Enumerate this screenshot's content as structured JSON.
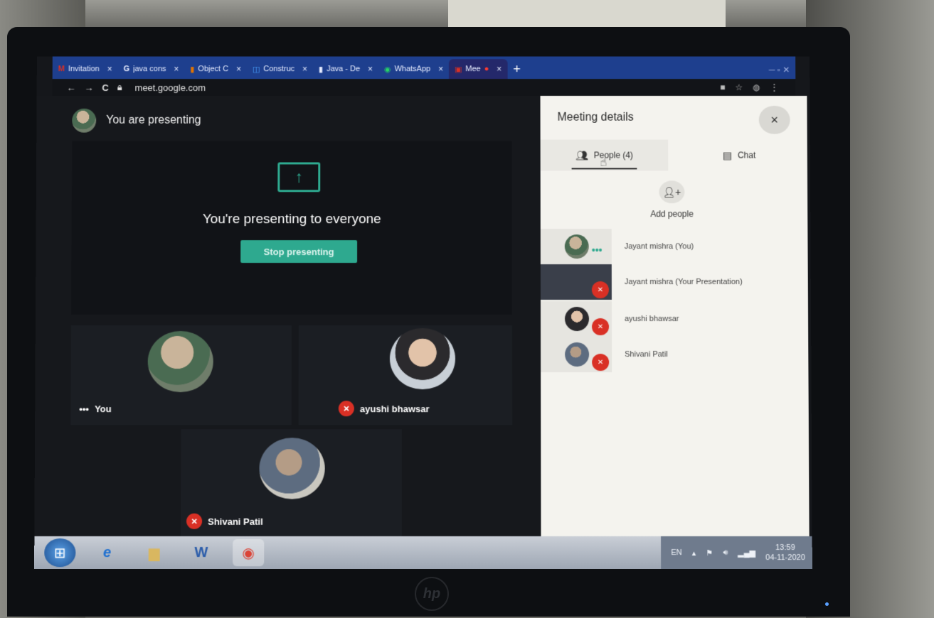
{
  "browser": {
    "tabs": [
      {
        "label": "Invitation",
        "icon": "gmail-icon",
        "color": "#d93025",
        "active": false
      },
      {
        "label": "java cons",
        "icon": "google-icon",
        "color": "#ffffff",
        "active": false
      },
      {
        "label": "Object C",
        "icon": "page-icon",
        "color": "#e37400",
        "active": false
      },
      {
        "label": "Construc",
        "icon": "page-icon",
        "color": "#4aa3ff",
        "active": false
      },
      {
        "label": "Java - De",
        "icon": "bookmark-icon",
        "color": "#ffffff",
        "active": false
      },
      {
        "label": "WhatsApp",
        "icon": "whatsapp-icon",
        "color": "#25d366",
        "active": false
      },
      {
        "label": "Mee",
        "icon": "meet-icon",
        "color": "#d93025",
        "active": true
      }
    ],
    "tab_close": "×",
    "new_tab": "+",
    "url": "meet.google.com",
    "nav_back": "←",
    "nav_forward": "→",
    "nav_reload": "C"
  },
  "meeting": {
    "presenting_header": "You are presenting",
    "present_message": "You're presenting to everyone",
    "stop_button": "Stop presenting",
    "tiles": [
      {
        "name": "You",
        "prefix": "•••"
      },
      {
        "name": "ayushi bhawsar"
      },
      {
        "name": "Shivani Patil"
      }
    ]
  },
  "panel": {
    "title": "Meeting details",
    "close": "×",
    "tab_people": "People (4)",
    "tab_chat": "Chat",
    "add_people": "Add people",
    "participants": [
      {
        "name": "Jayant mishra (You)",
        "status": "active"
      },
      {
        "name": "Jayant mishra (Your Presentation)",
        "status": "muted"
      },
      {
        "name": "ayushi bhawsar",
        "status": "muted"
      },
      {
        "name": "Shivani Patil",
        "status": "muted"
      }
    ]
  },
  "taskbar": {
    "lang": "EN",
    "time": "13:59",
    "date": "04-11-2020"
  },
  "colors": {
    "accent": "#2ea98f",
    "mute": "#d93025",
    "tabbar": "#1e3f8e"
  }
}
